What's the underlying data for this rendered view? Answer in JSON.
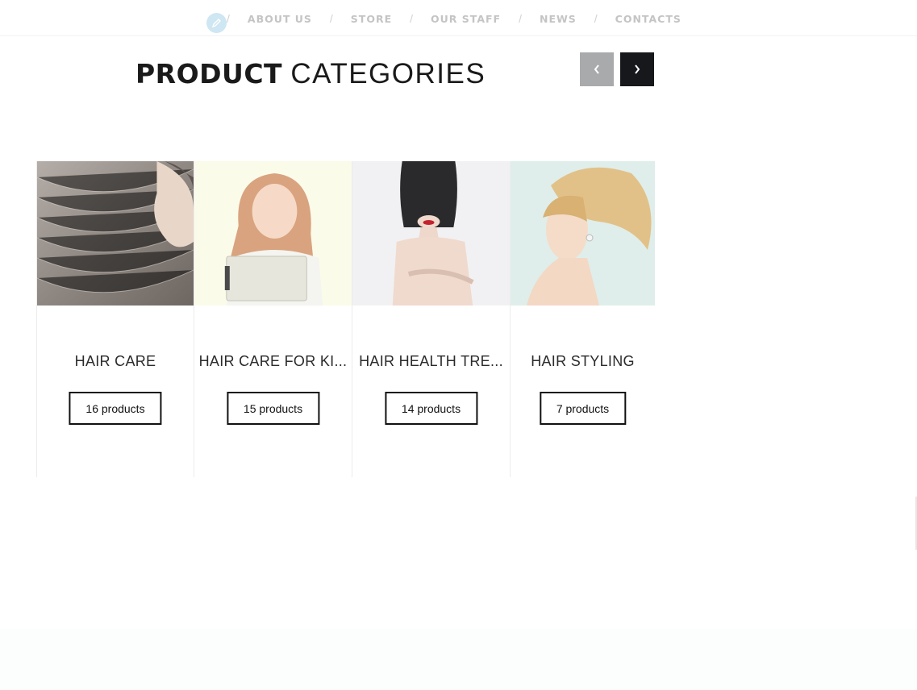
{
  "nav": {
    "items": [
      {
        "label": "ABOUT US"
      },
      {
        "label": "STORE"
      },
      {
        "label": "OUR STAFF"
      },
      {
        "label": "NEWS"
      },
      {
        "label": "CONTACTS"
      }
    ],
    "separator": "/"
  },
  "heading": {
    "bold": "PRODUCT",
    "light": "CATEGORIES"
  },
  "carousel": {
    "prev_icon": "chevron-left-icon",
    "next_icon": "chevron-right-icon"
  },
  "categories": [
    {
      "title": "HAIR CARE",
      "count": "16 products"
    },
    {
      "title": "HAIR CARE FOR KI...",
      "count": "15 products"
    },
    {
      "title": "HAIR HEALTH TRE...",
      "count": "14 products"
    },
    {
      "title": "HAIR STYLING",
      "count": "7 products"
    }
  ],
  "colors": {
    "accent_dark": "#16181b",
    "button_disabled": "#a8aaab",
    "nav_text": "#c4c4c4",
    "edit_badge": "#cfe6f3"
  }
}
